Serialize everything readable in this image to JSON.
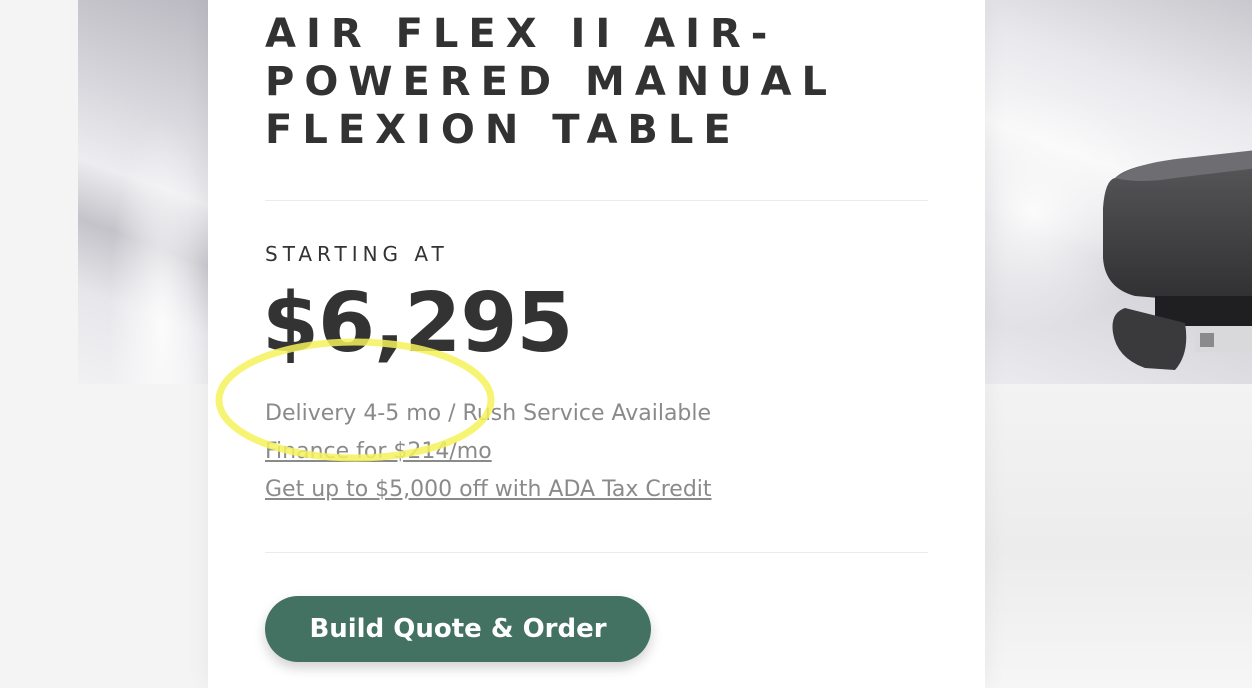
{
  "product": {
    "title": "AIR FLEX II AIR-POWERED MANUAL FLEXION TABLE",
    "starting_label": "STARTING AT",
    "price": "$6,295",
    "delivery": "Delivery 4-5 mo / Rush Service Available",
    "finance_link": "Finance for $214/mo",
    "tax_link": "Get up to $5,000 off with ADA Tax Credit",
    "cta_label": "Build Quote & Order"
  },
  "colors": {
    "accent": "#437263",
    "highlight": "#f6f25a",
    "text_dark": "#333333",
    "text_muted": "#8a8a8a"
  }
}
